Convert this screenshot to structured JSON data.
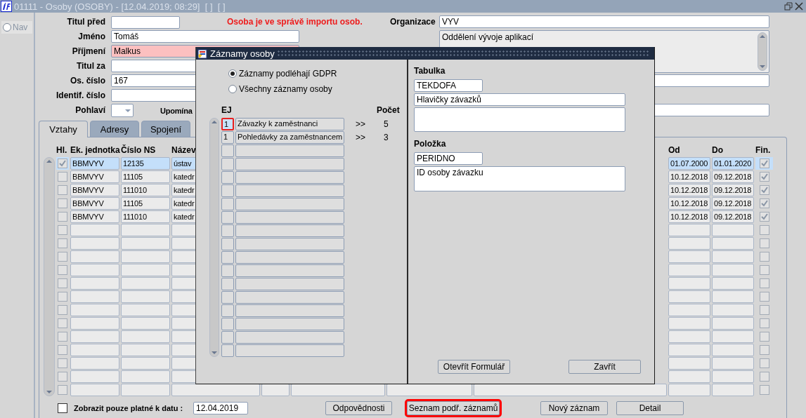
{
  "window": {
    "title": "01111 - Osoby (OSOBY) - [12.04.2019; 08:29]  [ ]  [ ]"
  },
  "nav": {
    "label": "Nav",
    "selected": false
  },
  "form": {
    "title_before": {
      "label": "Titul před"
    },
    "notice": "Osoba je ve správě importu osob.",
    "first_name": {
      "label": "Jméno",
      "value": "Tomáš"
    },
    "surname": {
      "label": "Příjmení",
      "value": "Malkus",
      "highlighted": true
    },
    "title_after": {
      "label": "Titul za"
    },
    "personal_number": {
      "label": "Os. číslo",
      "value": "167"
    },
    "identification_number": {
      "label": "Identif. číslo"
    },
    "gender": {
      "label": "Pohlaví"
    },
    "reminder_label": "Upomína",
    "organization": {
      "label": "Organizace",
      "value": "VYV"
    },
    "organization_detail": "Oddělení vývoje aplikací"
  },
  "tabs": [
    {
      "label": "Vztahy",
      "selected": true
    },
    {
      "label": "Adresy",
      "selected": false
    },
    {
      "label": "Spojení",
      "selected": false
    }
  ],
  "table": {
    "columns": [
      "Hl.",
      "Ek. jednotka",
      "Číslo NS",
      "Název",
      "Od",
      "Do",
      "Fin."
    ],
    "rows": [
      {
        "selected": true,
        "hl": true,
        "unit": "BBMVYV",
        "ns": "12135",
        "name": "ústav",
        "from": "01.07.2000",
        "to": "01.01.2020",
        "fin": true
      },
      {
        "selected": false,
        "hl": false,
        "unit": "BBMVYV",
        "ns": "11105",
        "name": "katedr",
        "from": "10.12.2018",
        "to": "09.12.2018",
        "fin": true
      },
      {
        "selected": false,
        "hl": false,
        "unit": "BBMVYV",
        "ns": "111010",
        "name": "katedr",
        "from": "10.12.2018",
        "to": "09.12.2018",
        "fin": true
      },
      {
        "selected": false,
        "hl": false,
        "unit": "BBMVYV",
        "ns": "11105",
        "name": "katedr",
        "from": "10.12.2018",
        "to": "09.12.2018",
        "fin": true
      },
      {
        "selected": false,
        "hl": false,
        "unit": "BBMVYV",
        "ns": "111010",
        "name": "katedr",
        "from": "10.12.2018",
        "to": "09.12.2018",
        "fin": true
      },
      {
        "selected": false,
        "hl": false,
        "fin": false
      },
      {
        "selected": false,
        "hl": false,
        "fin": false
      },
      {
        "selected": false,
        "hl": false,
        "fin": false
      },
      {
        "selected": false,
        "hl": false,
        "fin": false
      },
      {
        "selected": false,
        "hl": false,
        "fin": false
      },
      {
        "selected": false,
        "hl": false,
        "fin": false
      },
      {
        "selected": false,
        "hl": false,
        "fin": false
      },
      {
        "selected": false,
        "hl": false,
        "fin": false
      },
      {
        "selected": false,
        "hl": false,
        "fin": false
      },
      {
        "selected": false,
        "hl": false,
        "fin": false
      },
      {
        "selected": false,
        "hl": false,
        "fin": false
      },
      {
        "selected": false,
        "hl": false,
        "fin": false
      },
      {
        "selected": false,
        "hl": false,
        "fin": false
      }
    ]
  },
  "filter": {
    "label": "Zobrazit pouze platné k datu :",
    "checked": false,
    "date": "12.04.2019"
  },
  "buttons": [
    {
      "label": "Odpovědnosti",
      "highlighted": false
    },
    {
      "label": "Seznam podř. záznamů",
      "highlighted": true
    },
    {
      "label": "Nový záznam",
      "highlighted": false
    },
    {
      "label": "Detail",
      "highlighted": false
    }
  ],
  "dialog": {
    "title": "Záznamy osoby",
    "options": [
      {
        "label": "Záznamy podléhají GDPR",
        "selected": true
      },
      {
        "label": "Všechny záznamy osoby",
        "selected": false
      }
    ],
    "columns": [
      "EJ",
      "Počet"
    ],
    "rows": [
      {
        "selected": true,
        "ej": "1",
        "name": "Závazky k zaměstnanci",
        "link": ">>",
        "count": "5"
      },
      {
        "selected": false,
        "ej": "1",
        "name": "Pohledávky za zaměstnancem",
        "link": ">>",
        "count": "3"
      },
      {
        "selected": false
      },
      {
        "selected": false
      },
      {
        "selected": false
      },
      {
        "selected": false
      },
      {
        "selected": false
      },
      {
        "selected": false
      },
      {
        "selected": false
      },
      {
        "selected": false
      },
      {
        "selected": false
      },
      {
        "selected": false
      },
      {
        "selected": false
      },
      {
        "selected": false
      },
      {
        "selected": false
      },
      {
        "selected": false
      },
      {
        "selected": false
      },
      {
        "selected": false
      }
    ],
    "table_label": "Tabulka",
    "table_code": "TEKDOFA",
    "table_name": "Hlavičky závazků",
    "item_label": "Položka",
    "item_code": "PERIDNO",
    "item_name": "ID osoby závazku",
    "buttons": [
      {
        "label": "Otevřít Formulář"
      },
      {
        "label": "Zavřít"
      }
    ]
  }
}
